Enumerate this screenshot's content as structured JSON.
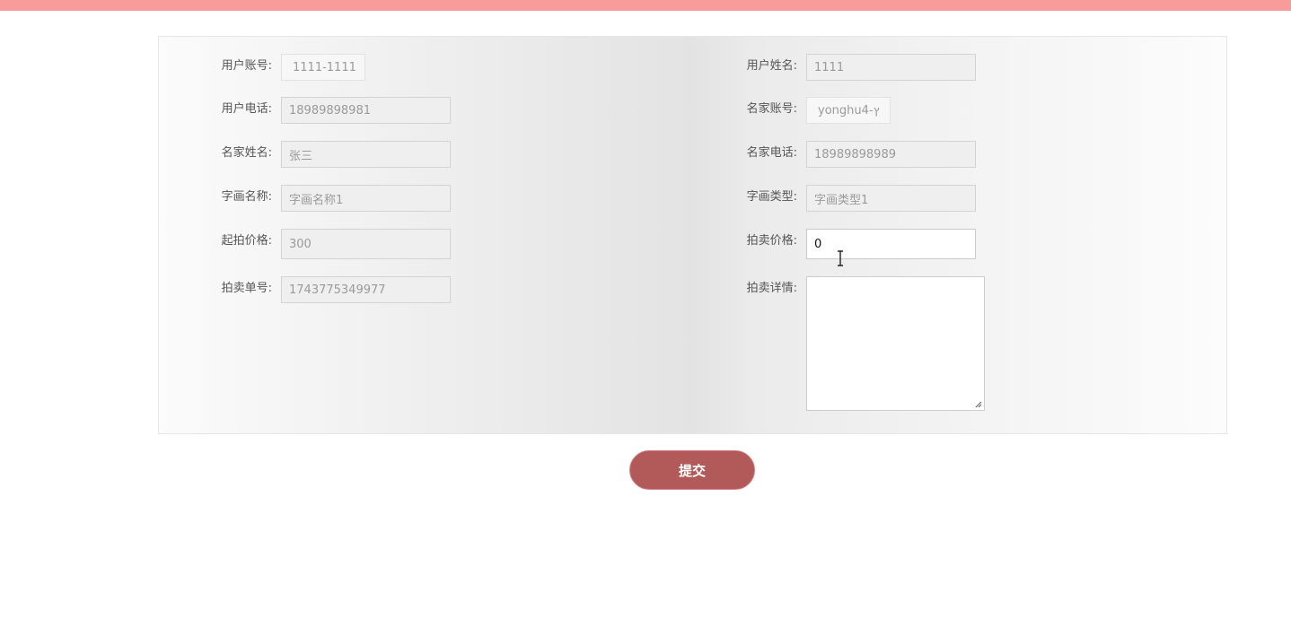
{
  "form": {
    "left": [
      {
        "label": "用户账号:",
        "value": "1111-1111"
      },
      {
        "label": "用户电话:",
        "value": "18989898981"
      },
      {
        "label": "名家姓名:",
        "value": "张三"
      },
      {
        "label": "字画名称:",
        "value": "字画名称1"
      },
      {
        "label": "起拍价格:",
        "value": "300"
      },
      {
        "label": "拍卖单号:",
        "value": "1743775349977"
      }
    ],
    "right": [
      {
        "label": "用户姓名:",
        "value": "1111"
      },
      {
        "label": "名家账号:",
        "value": "yonghu4-ץ"
      },
      {
        "label": "名家电话:",
        "value": "18989898989"
      },
      {
        "label": "字画类型:",
        "value": "字画类型1"
      },
      {
        "label": "拍卖价格:",
        "value": "0"
      },
      {
        "label": "拍卖详情:",
        "value": ""
      }
    ]
  },
  "submit_label": "提交",
  "colors": {
    "top_bar": "#f79b9b",
    "submit_button": "#b25a5a"
  }
}
